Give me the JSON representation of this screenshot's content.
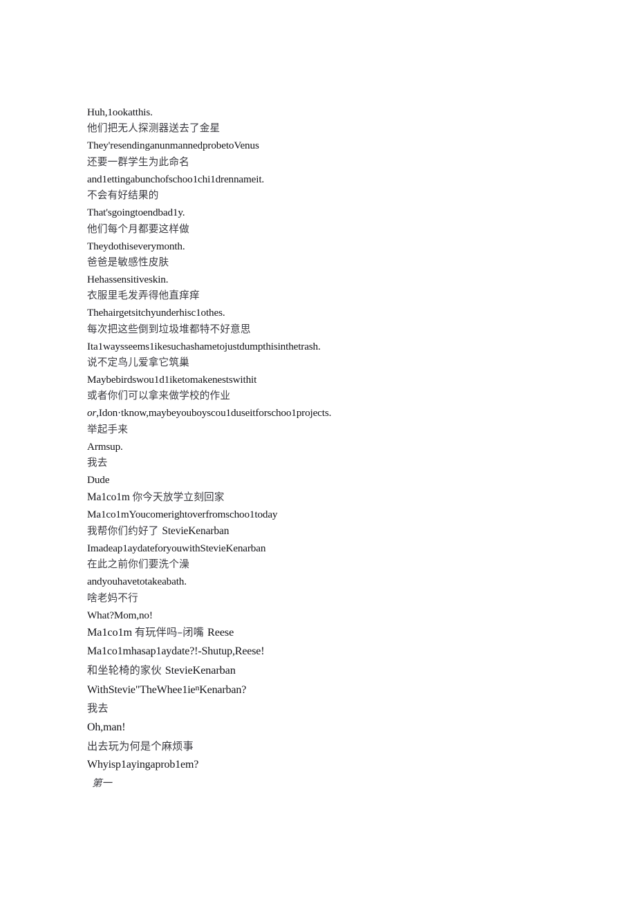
{
  "document": {
    "type": "bilingual-subtitle-transcript",
    "background_color": "#ffffff",
    "latin_text_color": "#121216",
    "chinese_text_color": "#3a3a40",
    "lines": [
      {
        "id": "l1",
        "lang": "en",
        "text": "Huh,1ookatthis."
      },
      {
        "id": "l2",
        "lang": "zh",
        "text": "他们把无人探测器送去了金星"
      },
      {
        "id": "l3",
        "lang": "en",
        "text": "They'resendinganunmannedprobetoVenus"
      },
      {
        "id": "l4",
        "lang": "zh",
        "text": "还要一群学生为此命名"
      },
      {
        "id": "l5",
        "lang": "en",
        "text": "and1ettingabunchofschoo1chi1drennameit."
      },
      {
        "id": "l6",
        "lang": "zh",
        "text": "不会有好结果的"
      },
      {
        "id": "l7",
        "lang": "en",
        "text": "That'sgoingtoendbad1y."
      },
      {
        "id": "l8",
        "lang": "zh",
        "text": "他们每个月都要这样做"
      },
      {
        "id": "l9",
        "lang": "en",
        "text": "Theydothiseverymonth."
      },
      {
        "id": "l10",
        "lang": "zh",
        "text": "爸爸是敏感性皮肤"
      },
      {
        "id": "l11",
        "lang": "en",
        "text": "Hehassensitiveskin."
      },
      {
        "id": "l12",
        "lang": "zh",
        "text": "衣服里毛发弄得他直痒痒"
      },
      {
        "id": "l13",
        "lang": "en",
        "text": "Thehairgetsitchyunderhisc1othes."
      },
      {
        "id": "l14",
        "lang": "zh",
        "text": "每次把这些倒到垃圾堆都特不好意思"
      },
      {
        "id": "l15",
        "lang": "en",
        "text": "Ita1waysseems1ikesuchashametojustdumpthisinthetrash."
      },
      {
        "id": "l16",
        "lang": "zh",
        "text": "说不定鸟儿爱拿它筑巢"
      },
      {
        "id": "l17",
        "lang": "en",
        "text": "Maybebirdswou1d1iketomakenestswithit"
      },
      {
        "id": "l18",
        "lang": "zh",
        "text": "或者你们可以拿来做学校的作业"
      },
      {
        "id": "l19",
        "lang": "en",
        "italic_prefix": "or",
        "text": ",Idon·tknow,maybeyouboyscou1duseitforschoo1projects."
      },
      {
        "id": "l20",
        "lang": "zh",
        "text": "举起手来"
      },
      {
        "id": "l21",
        "lang": "en",
        "text": "Armsup."
      },
      {
        "id": "l22",
        "lang": "zh",
        "text": "我去"
      },
      {
        "id": "l23",
        "lang": "en",
        "text": "Dude"
      },
      {
        "id": "l24",
        "lang": "mixed",
        "latin_prefix": "Ma1co1m ",
        "zh_text": "你今天放学立刻回家"
      },
      {
        "id": "l25",
        "lang": "en",
        "text": "Ma1co1mYoucomerightoverfromschoo1today"
      },
      {
        "id": "l26",
        "lang": "mixed",
        "zh_prefix": "我帮你们约好了 ",
        "latin_text": "StevieKenarban"
      },
      {
        "id": "l27",
        "lang": "en",
        "text": "Imadeap1aydateforyouwithStevieKenarban"
      },
      {
        "id": "l28",
        "lang": "zh",
        "text": "在此之前你们要洗个澡"
      },
      {
        "id": "l29",
        "lang": "en",
        "text": "andyouhavetotakeabath."
      },
      {
        "id": "l30",
        "lang": "zh",
        "text": "啥老妈不行"
      },
      {
        "id": "l31",
        "lang": "en",
        "text": "What?Mom,no!"
      },
      {
        "id": "l32",
        "lang": "mixed",
        "loose": true,
        "latin_prefix": "Ma1co1m ",
        "zh_text": "有玩伴吗–闭嘴 ",
        "latin_suffix": "Reese"
      },
      {
        "id": "l33",
        "lang": "en",
        "loose": true,
        "text": "Ma1co1mhasap1aydate?!-Shutup,Reese!"
      },
      {
        "id": "l34",
        "lang": "mixed",
        "loose": true,
        "zh_prefix": "和坐轮椅的家伙 ",
        "latin_text": "StevieKenarban"
      },
      {
        "id": "l35",
        "lang": "en",
        "loose": true,
        "quote_open": "WithStevie\"TheWhee1ie",
        "raised_quote": "n",
        "quote_close": "Kenarban?"
      },
      {
        "id": "l36",
        "lang": "zh",
        "loose": true,
        "text": "我去"
      },
      {
        "id": "l37",
        "lang": "en",
        "loose": true,
        "text": "Oh,man!"
      },
      {
        "id": "l38",
        "lang": "zh",
        "loose": true,
        "text": "出去玩为何是个麻烦事"
      },
      {
        "id": "l39",
        "lang": "en",
        "loose": true,
        "text": "Whyisp1ayingaprob1em?"
      },
      {
        "id": "l40",
        "lang": "zh-slanted",
        "text": "第一"
      }
    ]
  }
}
